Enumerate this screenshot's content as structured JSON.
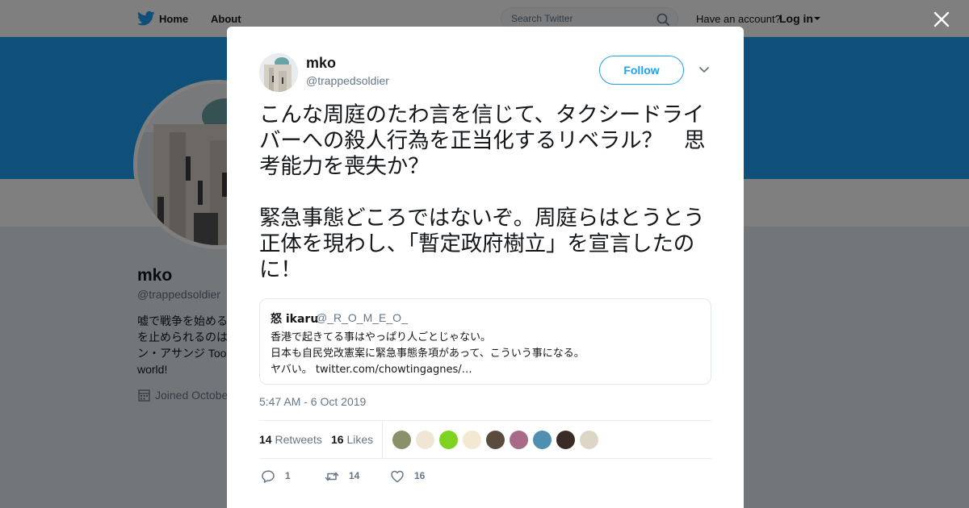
{
  "topbar": {
    "home_label": "Home",
    "about_label": "About",
    "search_placeholder": "Search Twitter",
    "have_account": "Have an account?",
    "login_label": "Log in"
  },
  "profile": {
    "name": "mko",
    "handle": "@trappedsoldier",
    "bio_lines": [
      "嘘で戦争を始める",
      "を止められるのは",
      "ン・アサンジ Too",
      "world!"
    ],
    "joined": "Joined October"
  },
  "tweet": {
    "author_name": "mko",
    "author_handle": "@trappedsoldier",
    "follow_label": "Follow",
    "text_para1": "こんな周庭のたわ言を信じて、タクシードライバーへの殺人行為を正当化するリベラル？　思考能力を喪失か？",
    "text_para2": "緊急事態どころではないぞ。周庭らはとうとう正体を現わし、「暫定政府樹立」を宣言したのに！",
    "quote": {
      "name": "怒 ikaru",
      "handle": "@_R_O_M_E_O_",
      "line1": "香港で起きてる事はやっぱり人ごとじゃない。",
      "line2": "日本も自民党改憲案に緊急事態条項があって、こういう事になる。",
      "line3_prefix": "ヤバい。 ",
      "line3_link": "twitter.com/chowtingagnes/…"
    },
    "timestamp": "5:47 AM - 6 Oct 2019",
    "retweets_count": "14",
    "retweets_label": "Retweets",
    "likes_count": "16",
    "likes_label": "Likes",
    "actions": {
      "reply_count": "1",
      "retweet_count": "14",
      "like_count": "16"
    }
  },
  "colors": {
    "brand": "#1da1f2",
    "text": "#14171a",
    "secondary": "#657786",
    "overlay": "rgba(0,0,0,0.5)"
  },
  "icons": [
    "twitter-bird-icon",
    "search-icon",
    "close-icon",
    "chevron-down-icon",
    "calendar-icon",
    "reply-icon",
    "retweet-icon",
    "heart-icon"
  ]
}
